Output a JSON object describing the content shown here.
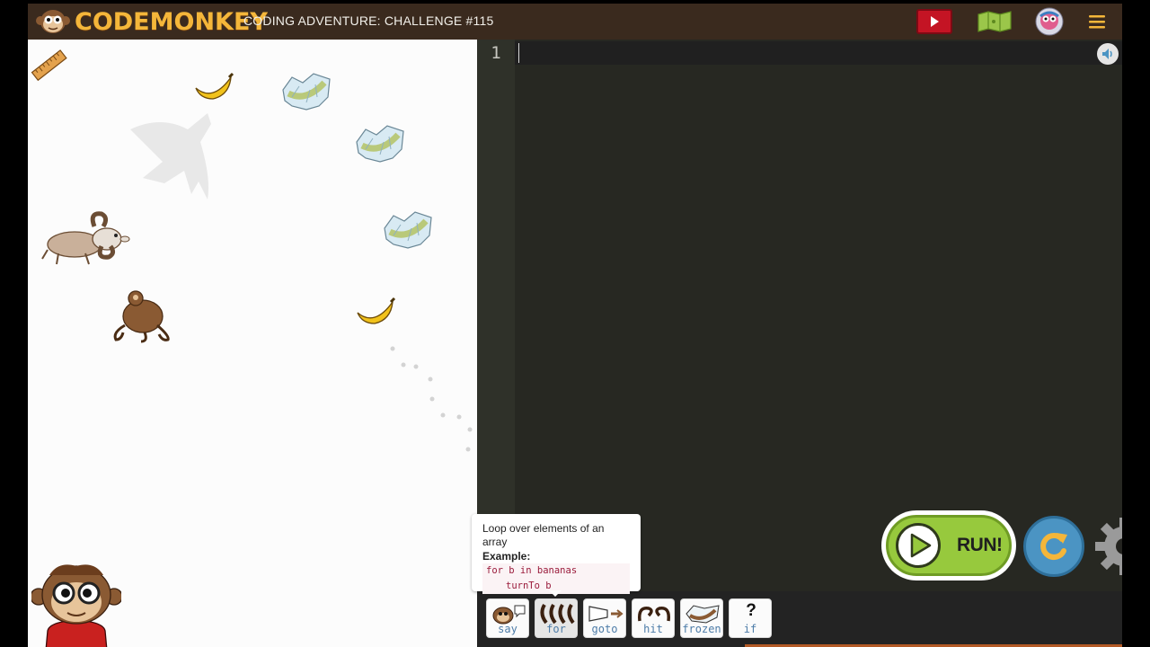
{
  "header": {
    "logo_text": "CODEMONKEY",
    "challenge_title": "CODING ADVENTURE: CHALLENGE #115"
  },
  "editor": {
    "line_numbers": [
      "1"
    ],
    "code": ""
  },
  "tooltip": {
    "description": "Loop over elements of an array",
    "example_label": "Example:",
    "code_lines": [
      "for b in bananas",
      "turnTo b"
    ]
  },
  "commands": [
    {
      "label": "say",
      "icon": "monkey-speech-icon"
    },
    {
      "label": "for",
      "icon": "bananas-icon"
    },
    {
      "label": "goto",
      "icon": "goto-icon"
    },
    {
      "label": "hit",
      "icon": "hit-icon"
    },
    {
      "label": "frozen",
      "icon": "frozen-banana-icon"
    },
    {
      "label": "if",
      "icon": "question-icon",
      "glyph": "?"
    }
  ],
  "run_button": {
    "label": "RUN!"
  },
  "colors": {
    "header_bg": "#3a2a1e",
    "logo": "#f4b63a",
    "editor_bg": "#272822",
    "run_green": "#97c93d",
    "reset_blue": "#4b94c3",
    "video_red": "#c41424",
    "code_red": "#9a1b3b"
  }
}
